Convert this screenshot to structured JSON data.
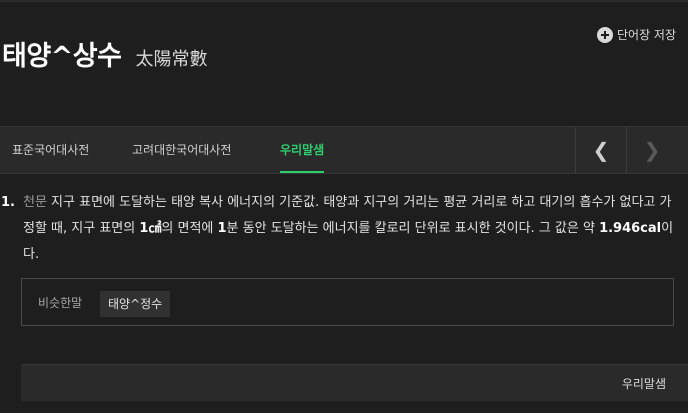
{
  "entry": {
    "headword": "태양^상수",
    "hanja": "太陽常數"
  },
  "actions": {
    "save_label": "단어장 저장",
    "save_icon": "plus-circle-icon"
  },
  "tabs": [
    {
      "label": "표준국어대사전",
      "active": false
    },
    {
      "label": "고려대한국어대사전",
      "active": false
    },
    {
      "label": "우리말샘",
      "active": true
    }
  ],
  "nav": {
    "prev_icon": "chevron-left-icon",
    "next_icon": "chevron-right-icon"
  },
  "definition": {
    "number": "1.",
    "field": "천문",
    "text_part1": " 지구 표면에 도달하는 태양 복사 에너지의 기준값. 태양과 지구의 거리는 평균 거리로 하고 대기의 흡수가 없다고 가정할 때, 지구 표면의 ",
    "bold1": "1㎠",
    "text_part2": "의 면적에 ",
    "bold2": "1",
    "text_part3": "분 동안 도달하는 에너지를 칼로리 단위로 표시한 것이다. 그 값은 약 ",
    "bold3": "1.946cal",
    "text_part4": "이다."
  },
  "synonyms": {
    "label": "비슷한말",
    "items": [
      "태양^정수"
    ]
  },
  "source": {
    "label": "우리말샘"
  },
  "colors": {
    "background": "#1e1e1e",
    "accent_green": "#2fcd6d",
    "tab_bar": "#2a2a2a"
  }
}
